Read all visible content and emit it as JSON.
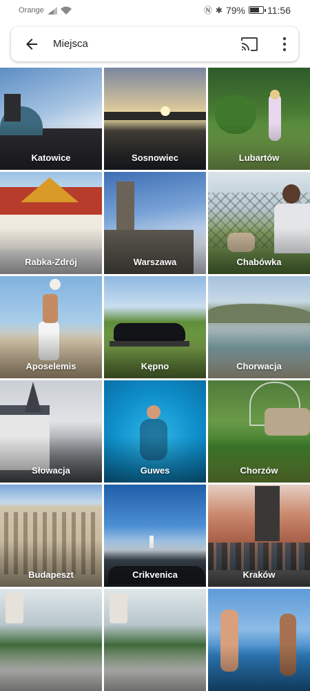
{
  "status": {
    "carrier": "Orange",
    "battery": "79%",
    "battery_level": 0.79,
    "time": "11:56"
  },
  "search": {
    "title": "Miejsca",
    "back_icon": "arrow-back-icon",
    "cast_icon": "cast-icon",
    "more_icon": "more-vert-icon"
  },
  "places": [
    {
      "label": "Katowice"
    },
    {
      "label": "Sosnowiec"
    },
    {
      "label": "Lubartów"
    },
    {
      "label": "Rabka-Zdrój"
    },
    {
      "label": "Warszawa"
    },
    {
      "label": "Chabówka"
    },
    {
      "label": "Aposelemis"
    },
    {
      "label": "Kępno"
    },
    {
      "label": "Chorwacja"
    },
    {
      "label": "Słowacja"
    },
    {
      "label": "Guwes"
    },
    {
      "label": "Chorzów"
    },
    {
      "label": "Budapeszt"
    },
    {
      "label": "Crikvenica"
    },
    {
      "label": "Kraków"
    },
    {
      "label": ""
    },
    {
      "label": ""
    },
    {
      "label": ""
    }
  ]
}
